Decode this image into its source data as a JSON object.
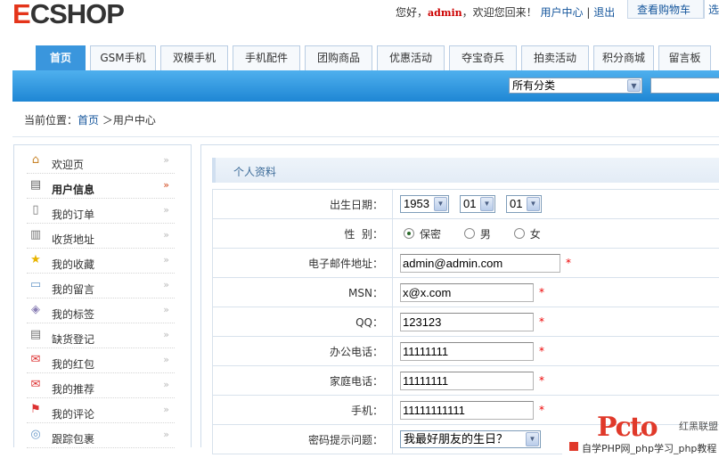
{
  "logo": {
    "e": "E",
    "rest": "CSHOP"
  },
  "top": {
    "greeting": "您好，",
    "username": "admin",
    "welcome": "，欢迎您回来！",
    "user_center": "用户中心",
    "sep": "|",
    "logout": "退出",
    "cart": "查看购物车",
    "cart2": "选"
  },
  "nav": {
    "tabs": [
      "首页",
      "GSM手机",
      "双模手机",
      "手机配件",
      "团购商品",
      "优惠活动",
      "夺宝奇兵",
      "拍卖活动",
      "积分商城",
      "留言板"
    ]
  },
  "search": {
    "category": "所有分类"
  },
  "breadcrumb": {
    "prefix": "当前位置：",
    "home": "首页",
    "arrow": "＞",
    "current": "用户中心"
  },
  "sidebar": {
    "items": [
      {
        "label": "欢迎页",
        "icon": "home-icon"
      },
      {
        "label": "用户信息",
        "icon": "id-card-icon"
      },
      {
        "label": "我的订单",
        "icon": "order-icon"
      },
      {
        "label": "收货地址",
        "icon": "address-book-icon"
      },
      {
        "label": "我的收藏",
        "icon": "star-icon"
      },
      {
        "label": "我的留言",
        "icon": "speech-bubble-icon"
      },
      {
        "label": "我的标签",
        "icon": "tag-icon"
      },
      {
        "label": "缺货登记",
        "icon": "notepad-icon"
      },
      {
        "label": "我的红包",
        "icon": "red-envelope-icon"
      },
      {
        "label": "我的推荐",
        "icon": "recommend-icon"
      },
      {
        "label": "我的评论",
        "icon": "flag-icon"
      },
      {
        "label": "跟踪包裹",
        "icon": "package-icon"
      }
    ],
    "active_index": 1
  },
  "profile": {
    "heading": "个人资料",
    "birthday_label": "出生日期：",
    "birth_year": "1953",
    "birth_month": "01",
    "birth_day": "01",
    "gender_label": "性  别：",
    "gender_options": [
      "保密",
      "男",
      "女"
    ],
    "gender_selected": "保密",
    "email_label": "电子邮件地址：",
    "email": "admin@admin.com",
    "msn_label": "MSN：",
    "msn": "x@x.com",
    "qq_label": "QQ：",
    "qq": "123123",
    "office_phone_label": "办公电话：",
    "office_phone": "11111111",
    "home_phone_label": "家庭电话：",
    "home_phone": "11111111",
    "mobile_label": "手机：",
    "mobile": "11111111111",
    "question_label": "密码提示问题：",
    "question": "我最好朋友的生日？",
    "required_mark": "*"
  },
  "watermark": {
    "big": "Pcto",
    "small": "红黑联盟",
    "bar": "自学PHP网_php学习_php教程"
  }
}
